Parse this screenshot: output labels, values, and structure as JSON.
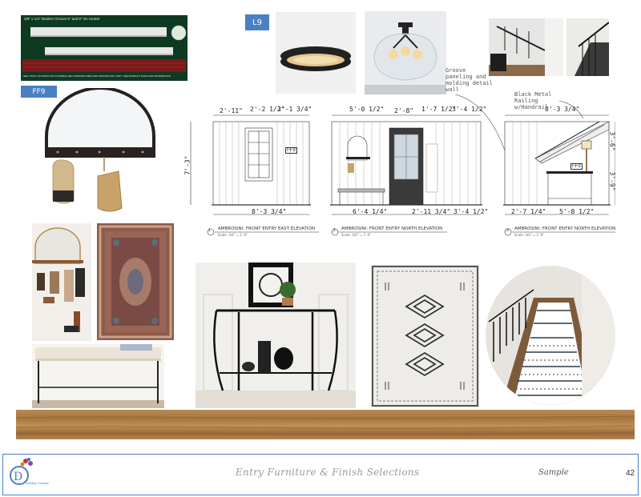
{
  "tags": {
    "l9": "L9",
    "ff9": "FF9"
  },
  "wainscot_spec": {
    "title": "3/8\" x 1/4\" Modern Groove 6\" and 8\" On Center",
    "note": "SEE YOUR LOCATION FOR SUITABLE USE HOWEVER SIZES AND SPACING MAY VARY. SEE PRODUCT PAGE FOR INFORMATION"
  },
  "drawings": {
    "east": {
      "dims_top": [
        "2'-11\"",
        "2'-2 1/2\"",
        "3'-1 3/4\""
      ],
      "dim_side": "7'-3\"",
      "dim_bottom": "8'-3 3/4\"",
      "tag": "FF9",
      "title": "AMBROSINI: FRONT ENTRY EAST ELEVATION",
      "scale": "Scale: 3/4\" = 1'-0\"",
      "marker": "1"
    },
    "north": {
      "dims_top": [
        "5'-0 1/2\"",
        "2'-8\"",
        "1'-7 1/2\"",
        "3'-4 1/2\""
      ],
      "dims_bottom": [
        "6'-4 1/4\"",
        "2'-11 3/4\"",
        "3'-4 1/2\""
      ],
      "title": "AMBROSINI: FRONT ENTRY NORTH ELEVATION",
      "scale": "Scale: 3/4\" = 1'-0\"",
      "marker": "2",
      "note": "Groove paneling and molding detail wall"
    },
    "north2": {
      "dim_top": "8'-3 3/4\"",
      "dims_side": [
        "3'-6\"",
        "3'-9\""
      ],
      "dims_bottom": [
        "2'-7 1/4\"",
        "5'-8 1/2\""
      ],
      "tag": "FF9",
      "title": "AMBROSINI: FRONT ENTRY NORTH ELEVATION",
      "scale": "Scale: 3/4\" = 1'-0\"",
      "marker": "3",
      "note": "Black Metal Railing w/Handrail"
    }
  },
  "footer": {
    "title": "Entry Furniture & Finish Selections",
    "sample": "Sample",
    "page": "42",
    "logo_text": "Dwelling Concepts"
  }
}
